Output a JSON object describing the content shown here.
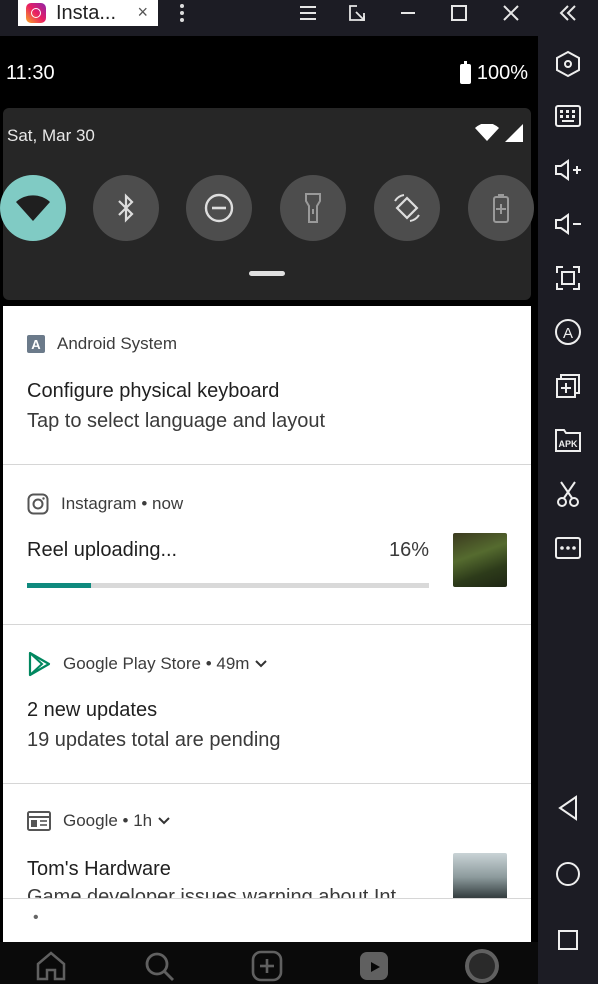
{
  "window": {
    "tab_title": "Insta...",
    "tab_close": "×"
  },
  "status_bar": {
    "time": "11:30",
    "battery": "100%"
  },
  "shade": {
    "date": "Sat, Mar 30",
    "quick_settings": [
      {
        "name": "wifi",
        "active": true
      },
      {
        "name": "bluetooth",
        "active": false
      },
      {
        "name": "do-not-disturb",
        "active": false
      },
      {
        "name": "flashlight",
        "active": false
      },
      {
        "name": "auto-rotate",
        "active": false
      },
      {
        "name": "battery-saver",
        "active": false
      }
    ]
  },
  "notifications": [
    {
      "app": "Android System",
      "title": "Configure physical keyboard",
      "text": "Tap to select language and layout"
    },
    {
      "app": "Instagram",
      "time": " • now",
      "title": "Reel uploading...",
      "progress_label": "16%",
      "progress": 0.16
    },
    {
      "app": "Google Play Store",
      "time": " • 49m",
      "title": "2 new updates",
      "text": "19 updates total are pending"
    },
    {
      "app": "Google",
      "time": " • 1h",
      "title": "Tom's Hardware",
      "text": "Game developer issues warning about Int"
    }
  ],
  "footer": {
    "dot": "•"
  },
  "colors": {
    "accent_teal": "#80cbc4",
    "progress": "#0f8a7e",
    "play_green": "#01875f"
  }
}
